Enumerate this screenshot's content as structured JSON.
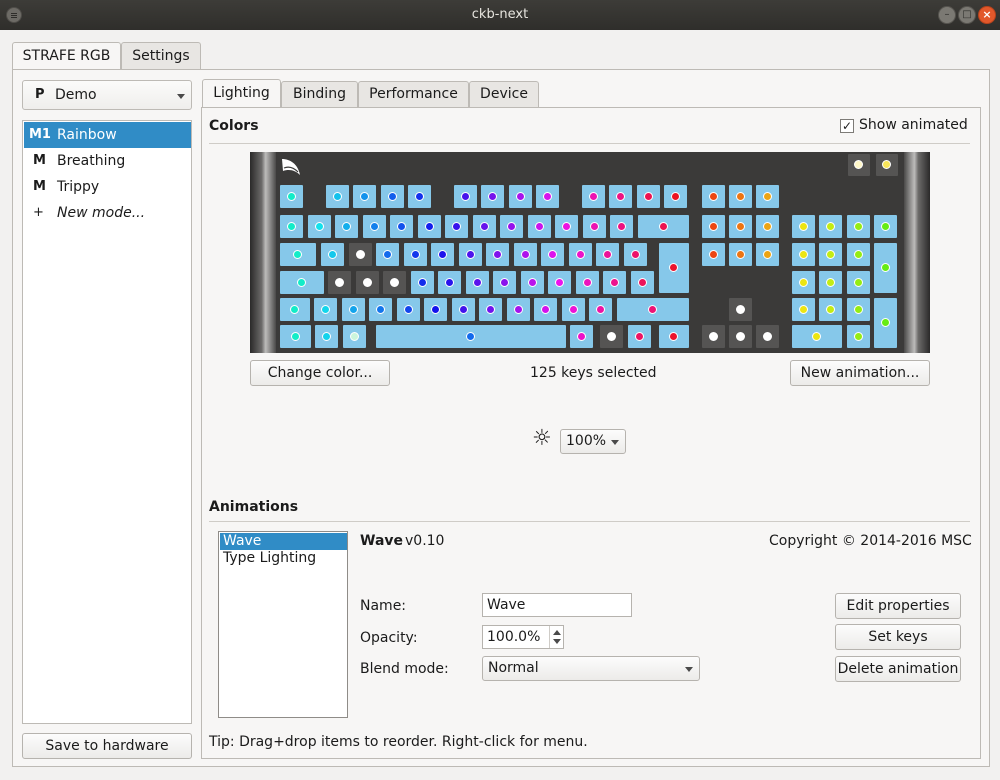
{
  "window": {
    "title": "ckb-next"
  },
  "device_tabs": [
    {
      "label": "STRAFE RGB",
      "active": true
    },
    {
      "label": "Settings",
      "active": false
    }
  ],
  "profile": {
    "prefix": "P",
    "name": "Demo"
  },
  "modes": [
    {
      "tag": "M1",
      "label": "Rainbow",
      "selected": true
    },
    {
      "tag": "M",
      "label": "Breathing",
      "selected": false
    },
    {
      "tag": "M",
      "label": "Trippy",
      "selected": false
    },
    {
      "tag": "+",
      "label": "New mode...",
      "selected": false
    }
  ],
  "save_button": "Save to hardware",
  "tabs": [
    "Lighting",
    "Binding",
    "Performance",
    "Device"
  ],
  "lighting": {
    "colors_title": "Colors",
    "show_animated": {
      "label": "Show animated",
      "checked": true,
      "mark": "✓"
    },
    "change_color_button": "Change color...",
    "keys_selected": "125 keys selected",
    "new_animation_button": "New animation...",
    "brightness_icon": "☼",
    "brightness_value": "100%"
  },
  "animations": {
    "title": "Animations",
    "list": [
      {
        "label": "Wave",
        "selected": true
      },
      {
        "label": "Type Lighting",
        "selected": false
      }
    ],
    "name": "Wave",
    "version": "v0.10",
    "copyright": "Copyright © 2014-2016 MSC",
    "name_label": "Name:",
    "name_value": "Wave",
    "opacity_label": "Opacity:",
    "opacity_value": "100.0%",
    "blend_label": "Blend mode:",
    "blend_value": "Normal",
    "edit_button": "Edit properties",
    "setkeys_button": "Set keys",
    "delete_button": "Delete animation",
    "tip": "Tip: Drag+drop items to reorder. Right-click for menu."
  },
  "colors": {
    "selection": "#308cc6",
    "key_fill": "#86c8ea",
    "keyboard_bg": "#3b3a39",
    "close_button": "#e2582b"
  }
}
